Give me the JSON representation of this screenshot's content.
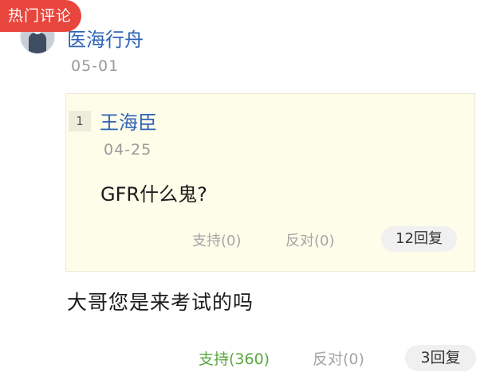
{
  "badge": {
    "label": "热门评论"
  },
  "comment": {
    "author": "医海行舟",
    "date": "05-01",
    "text": "大哥您是来考试的吗",
    "support": "支持(360)",
    "oppose": "反对(0)",
    "replies": "3回复"
  },
  "quoted": {
    "floor": "1",
    "author": "王海臣",
    "date": "04-25",
    "text": "GFR什么鬼?",
    "support": "支持(0)",
    "oppose": "反对(0)",
    "replies": "12回复"
  },
  "colors": {
    "badge": "#e8453c",
    "author": "#2f64b5",
    "support_active": "#59a83d",
    "muted": "#a6a6a6",
    "quote_bg": "#fdfdea"
  }
}
